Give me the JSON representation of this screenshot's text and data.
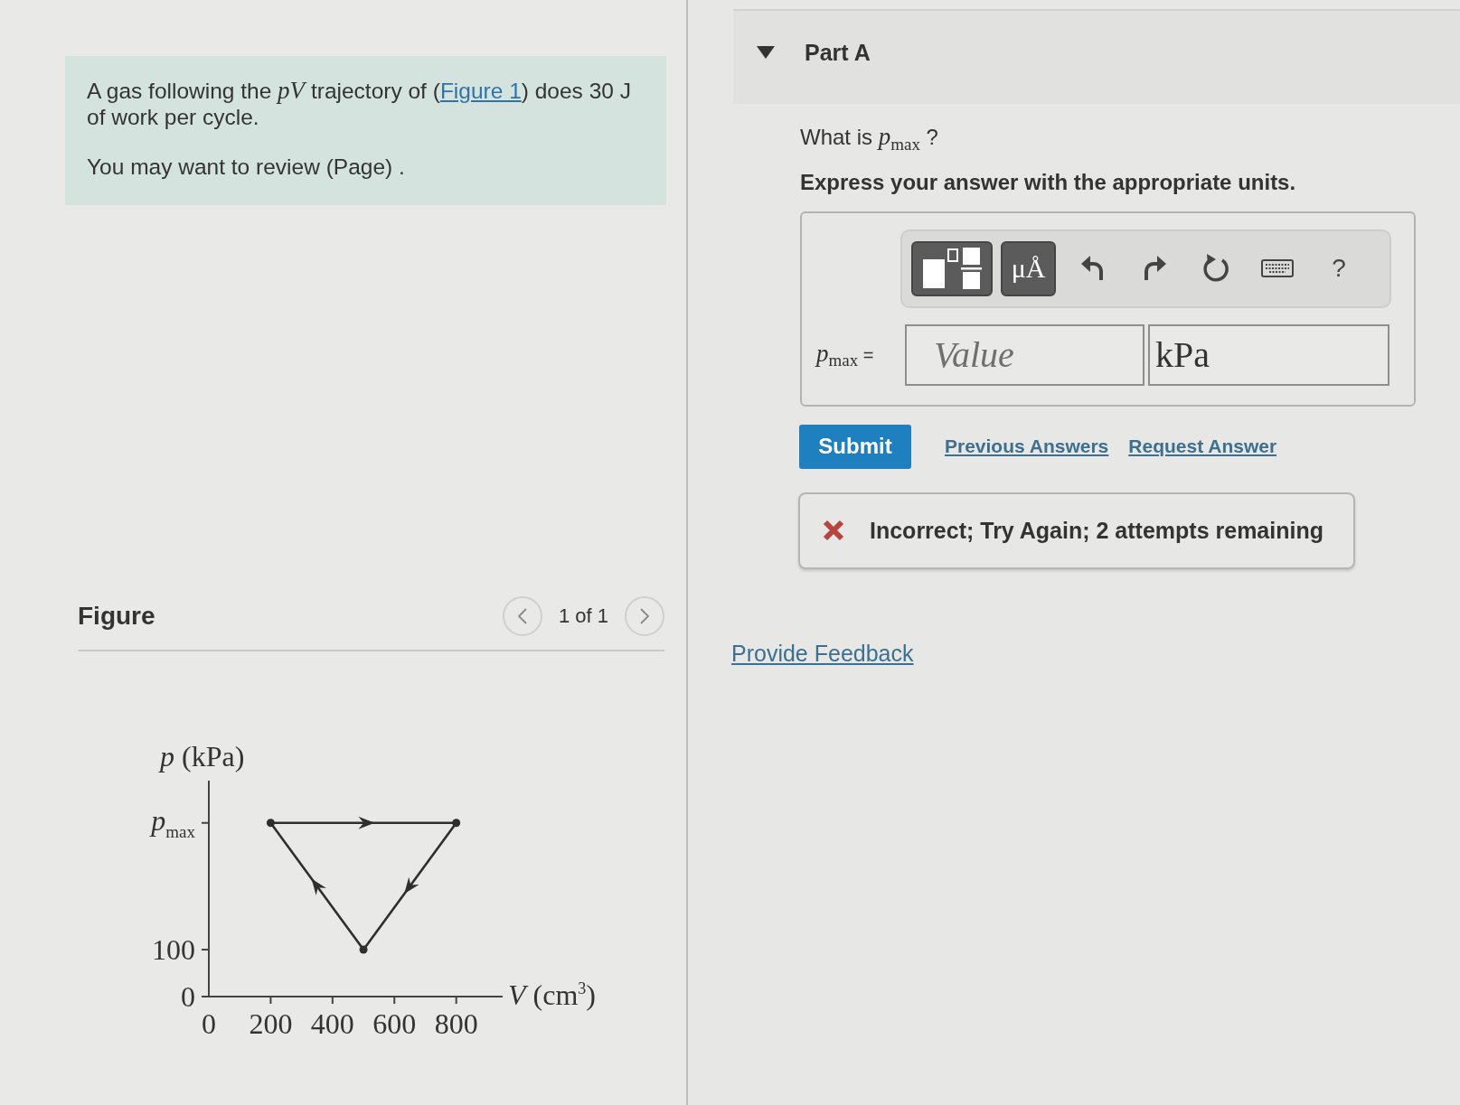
{
  "problem": {
    "statement": [
      {
        "kind": "text",
        "text": "A gas following the *pV* trajectory of ("
      },
      {
        "kind": "link",
        "text": "Figure 1"
      },
      {
        "kind": "text",
        "text": ") does 30 J of work per cycle."
      }
    ],
    "review": "You may want to review (Page) ."
  },
  "figure": {
    "title": "Figure",
    "pager": {
      "position": "1 of 1"
    },
    "chart_data": {
      "type": "line",
      "xlabel": "*V* (cm$^{3}$)",
      "ylabel": "*p* (kPa)",
      "series": [
        {
          "color": "#2e2e2e",
          "marker": "circle",
          "x": [
            200,
            800
          ],
          "values": [
            370,
            370
          ]
        },
        {
          "color": "#2e2e2e",
          "marker": "circle",
          "x": [
            800,
            500
          ],
          "values": [
            370,
            100
          ]
        },
        {
          "color": "#2e2e2e",
          "x": [
            500,
            200
          ],
          "values": [
            100,
            370
          ]
        }
      ],
      "xlim": [
        0,
        950
      ],
      "ylim": [
        0,
        460
      ],
      "xticks": [
        0,
        200,
        400,
        600,
        800
      ],
      "yticks": [
        0,
        100,
        {
          "value": 370,
          "label": "*p*$_{max}$"
        }
      ]
    }
  },
  "part": {
    "title": "Part A",
    "expanded": true,
    "question": "What is *p*$_{max}$ ?",
    "instruction": "Express your answer with the appropriate units.",
    "toolbar": [
      {
        "kind": "templates"
      },
      {
        "kind": "units",
        "label": "μÅ"
      },
      {
        "kind": "undo"
      },
      {
        "kind": "redo"
      },
      {
        "kind": "reset"
      },
      {
        "kind": "keyboard"
      },
      {
        "kind": "help",
        "label": "?"
      }
    ],
    "answer": {
      "label": "*p*$_{max}$ =",
      "value_field": {
        "placeholder": "Value"
      },
      "units_field": {
        "value": "kPa"
      }
    },
    "submit": "Submit",
    "links": [
      "Previous Answers",
      "Request Answer"
    ],
    "feedback": {
      "kind": "incorrect",
      "text": "Incorrect; Try Again; 2 attempts remaining"
    }
  },
  "provide_feedback": "Provide Feedback"
}
